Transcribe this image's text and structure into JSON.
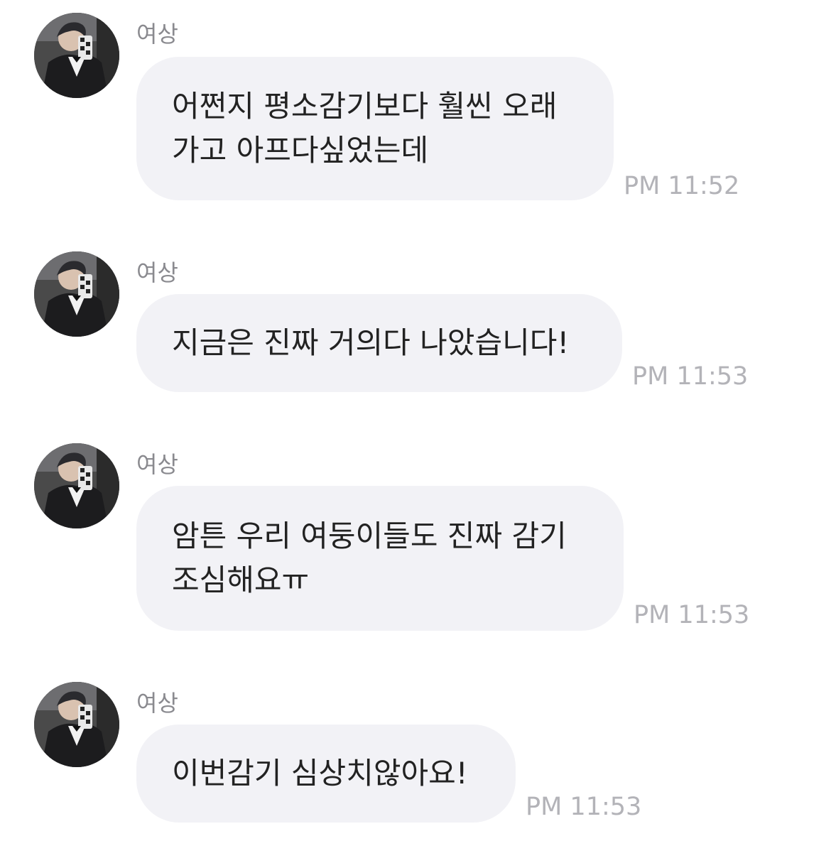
{
  "messages": [
    {
      "sender": "여상",
      "text": "어쩐지 평소감기보다 훨씬 오래\n가고 아프다싶었는데",
      "time": "PM 11:52",
      "avatar": "profile-photo"
    },
    {
      "sender": "여상",
      "text": "지금은 진짜 거의다 나았습니다!",
      "time": "PM 11:53",
      "avatar": "profile-photo"
    },
    {
      "sender": "여상",
      "text": "암튼 우리 여둥이들도 진짜 감기\n조심해요ㅠ",
      "time": "PM 11:53",
      "avatar": "profile-photo"
    },
    {
      "sender": "여상",
      "text": "이번감기 심상치않아요!",
      "time": "PM 11:53",
      "avatar": "profile-photo"
    }
  ],
  "colors": {
    "bubble": "#f2f2f6",
    "text": "#222222",
    "sender": "#8a8a8f",
    "time": "#b3b3b8"
  }
}
